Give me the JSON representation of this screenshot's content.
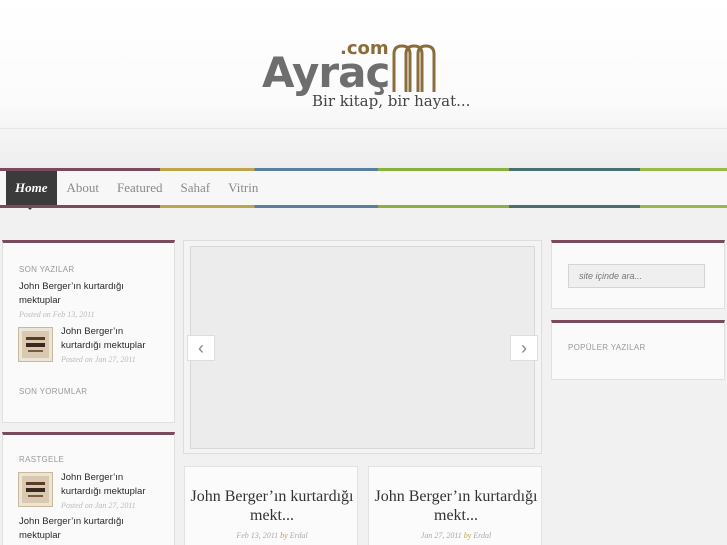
{
  "site": {
    "logo_main": "Ayraç",
    "logo_com": ".com",
    "tagline": "Bir kitap, bir hayat..."
  },
  "nav": {
    "items": [
      {
        "label": "Home",
        "active": true
      },
      {
        "label": "About"
      },
      {
        "label": "Featured"
      },
      {
        "label": "Sahaf"
      },
      {
        "label": "Vitrin"
      }
    ]
  },
  "left_sidebar": {
    "recent": {
      "title": "SON YAZILAR",
      "posts": [
        {
          "title": "John Berger’ın kurtardığı mektuplar",
          "meta": "Posted on Feb 13, 2011"
        },
        {
          "title": "John Berger’ın kurtardığı mektuplar",
          "meta": "Posted on Jan 27, 2011"
        }
      ]
    },
    "comments": {
      "title": "SON YORUMLAR"
    },
    "random": {
      "title": "RASTGELE",
      "posts": [
        {
          "title": "John Berger’ın kurtardığı mektuplar",
          "meta": "Posted on Jan 27, 2011"
        },
        {
          "title": "John Berger’ın kurtardığı mektuplar"
        }
      ]
    }
  },
  "slider": {
    "prev_icon": "‹",
    "next_icon": "›"
  },
  "posts": [
    {
      "title": "John Berger’ın kurtardığı mekt...",
      "date": "Feb 13, 2011",
      "by": "by",
      "author": "Erdal"
    },
    {
      "title": "John Berger’ın kurtardığı mekt...",
      "date": "Jan 27, 2011",
      "by": "by",
      "author": "Erdal"
    }
  ],
  "right_sidebar": {
    "search_placeholder": "site içinde ara...",
    "popular_title": "POPÜLER YAZILAR"
  },
  "colors": {
    "accent": "#7a4a5e",
    "logo_gold": "#8a6d3a",
    "nav_active_bg": "#3b3b3b"
  }
}
